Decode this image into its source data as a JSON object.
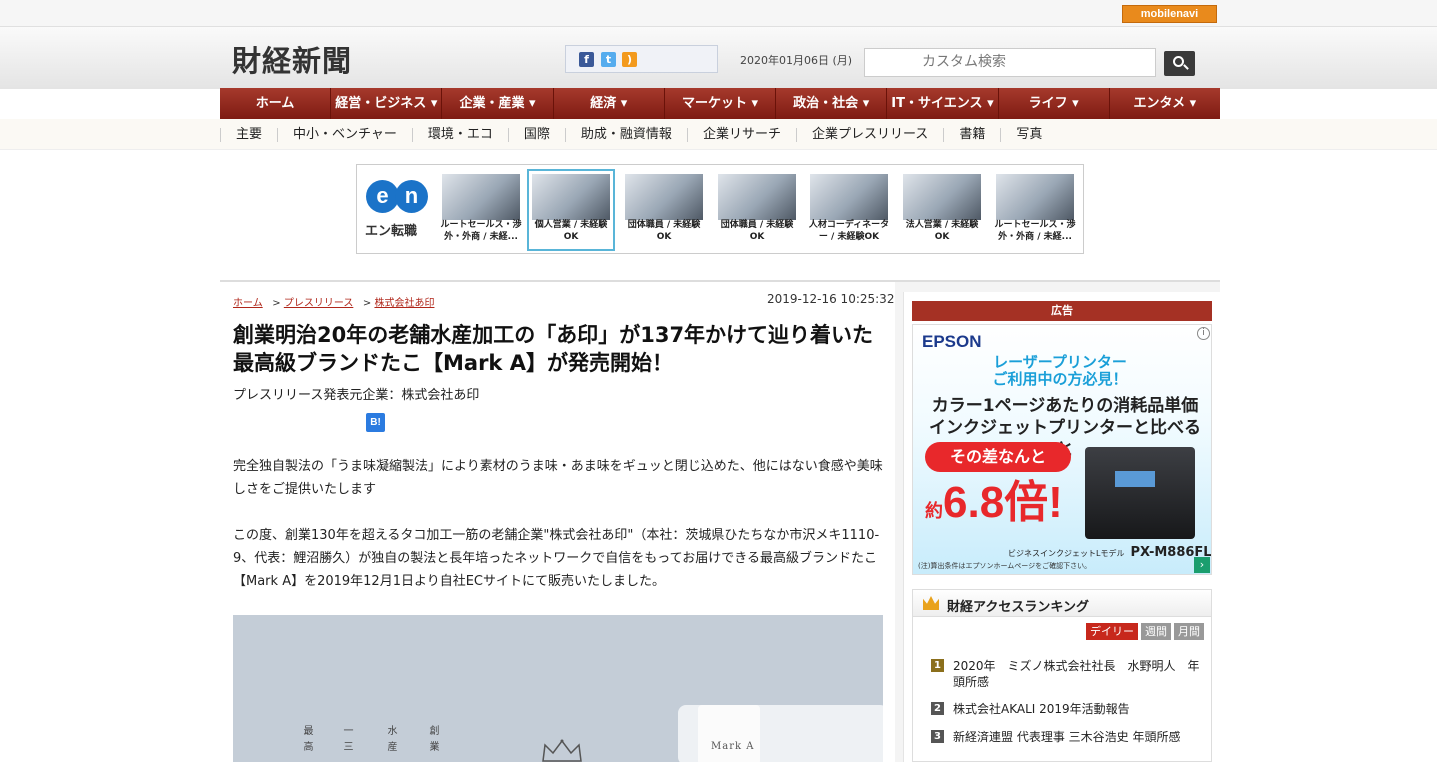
{
  "topbar": {
    "mobile_navi": "mobilenavi"
  },
  "header": {
    "logo": "財経新聞",
    "date": "2020年01月06日 (月)",
    "search_placeholder": "カスタム検索"
  },
  "social": [
    {
      "name": "facebook-icon",
      "glyph": "f",
      "color": "#3b5998"
    },
    {
      "name": "twitter-icon",
      "glyph": "t",
      "color": "#55acee"
    },
    {
      "name": "rss-icon",
      "glyph": ")",
      "color": "#f39a1d"
    }
  ],
  "nav": [
    {
      "label": "ホーム"
    },
    {
      "label": "経営・ビジネス ▾"
    },
    {
      "label": "企業・産業 ▾"
    },
    {
      "label": "経済 ▾"
    },
    {
      "label": "マーケット ▾"
    },
    {
      "label": "政治・社会 ▾"
    },
    {
      "label": "IT・サイエンス ▾"
    },
    {
      "label": "ライフ ▾"
    },
    {
      "label": "エンタメ ▾"
    }
  ],
  "subnav": [
    {
      "label": "主要"
    },
    {
      "label": "中小・ベンチャー"
    },
    {
      "label": "環境・エコ"
    },
    {
      "label": "国際"
    },
    {
      "label": "助成・融資情報"
    },
    {
      "label": "企業リサーチ"
    },
    {
      "label": "企業プレスリリース"
    },
    {
      "label": "書籍"
    },
    {
      "label": "写真"
    }
  ],
  "jobs": {
    "brand_e": "e",
    "brand_n": "n",
    "brand_text": "エン転職",
    "items": [
      {
        "caption": "ルートセールス・渉外・外商 / 未経..."
      },
      {
        "caption": "個人営業 / 未経験OK"
      },
      {
        "caption": "団体職員 / 未経験OK"
      },
      {
        "caption": "団体職員 / 未経験OK"
      },
      {
        "caption": "人材コーディネーター / 未経験OK"
      },
      {
        "caption": "法人営業 / 未経験OK"
      },
      {
        "caption": "ルートセールス・渉外・外商 / 未経..."
      }
    ]
  },
  "breadcrumb": {
    "home": "ホーム",
    "sep": ">",
    "press": "プレスリリース",
    "company": "株式会社あ印"
  },
  "article": {
    "timestamp": "2019-12-16 10:25:32",
    "title": "創業明治20年の老舗水産加工の「あ印」が137年かけて辿り着いた最高級ブランドたこ【Mark A】が発売開始！",
    "publisher": "プレスリリース発表元企業：株式会社あ印",
    "hatena": "B!",
    "para1": "完全独自製法の「うま味凝縮製法」により素材のうま味・あま味をギュッと閉じ込めた、他にはない食感や美味しさをご提供いたします",
    "para2": "この度、創業130年を超えるタコ加工一筋の老舗企業\"株式会社あ印\"（本社：茨城県ひたちなか市沢メキ1110-9、代表：鯉沼勝久）が独自の製法と長年培ったネットワークで自信をもってお届けできる最高級ブランドたこ【Mark A】を2019年12月1日より自社ECサイトにて販売いたしました。",
    "image_text": {
      "col1": "最高",
      "col2": "一三",
      "col3": "水産",
      "col4": "創業",
      "card": "Mark A"
    }
  },
  "ad": {
    "header": "広告",
    "brand": "EPSON",
    "headline1": "レーザープリンター ご利用中の方必見！",
    "headline2": "カラー1ページあたりの消耗品単価 インクジェットプリンターと比べると",
    "pill": "その差なんと",
    "prefix": "約",
    "value": "6.8倍!",
    "model_label": "ビジネスインクジェットLモデル",
    "model": "PX-M886FL",
    "note": "(注)算出条件はエプソンホームページをご確認下さい。"
  },
  "ranking": {
    "title": "財経アクセスランキング",
    "tabs": [
      {
        "label": "デイリー"
      },
      {
        "label": "週間"
      },
      {
        "label": "月間"
      }
    ],
    "items": [
      {
        "rank": "1",
        "text": "2020年　ミズノ株式会社社長　水野明人　年頭所感"
      },
      {
        "rank": "2",
        "text": "株式会社AKALI 2019年活動報告"
      },
      {
        "rank": "3",
        "text": "新経済連盟 代表理事 三木谷浩史 年頭所感"
      }
    ]
  }
}
